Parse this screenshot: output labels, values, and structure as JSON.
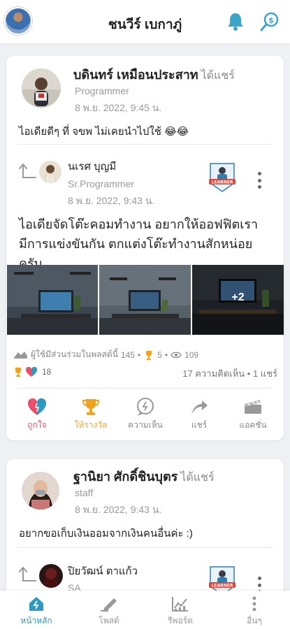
{
  "header": {
    "title": "ชนวีร์ เบกาภู่"
  },
  "post1": {
    "author_name": "บดินทร์ เหมือนประสาท",
    "shared_label": "ได้แชร์",
    "author_role": "Programmer",
    "date": "8 พ.ย. 2022, 9:45 น.",
    "text": "ไอเดียดีๆ ที่ จขพ ไม่เคยนำไปใช้ 😂😂",
    "original": {
      "author_name": "นเรศ บุญมี",
      "author_role": "Sr.Programmer",
      "date": "8 พ.ย. 2022, 9:43 น.",
      "badge_text": "LEARNER",
      "text": "ไอเดียจัดโต๊ะคอมทำงาน อยากให้ออฟฟิตเรามีการแข่งขันกัน ตกแต่งโต๊ะทำงานสักหน่อยครับ",
      "more_photos": "+2"
    },
    "stats": {
      "participants_label": "ผู้ใช้มีส่วนร่วมในพลสต์นี้",
      "participants": "145",
      "awards": "5",
      "views": "109",
      "reactions": "18",
      "comments_shares": "17 ความคิดเห็น • 1 แชร์"
    },
    "actions": {
      "like": "ถูกใจ",
      "award": "ให้รางวัล",
      "comment": "ความเห็น",
      "share": "แชร์",
      "acknowledge": "แอคชั่น"
    },
    "colors": {
      "like": "#e94f6a",
      "award": "#f2a31c",
      "inactive": "#888888"
    }
  },
  "post2": {
    "author_name": "ฐานิยา ศักดิ์ชินบุตร",
    "shared_label": "ได้แชร์",
    "author_role": "staff",
    "date": "8 พ.ย. 2022, 9:43 น.",
    "text": "อยากขอเก็บเงินออมจากเงินคนอื่นค่ะ :)",
    "original": {
      "author_name": "ปิยวัฒน์ ตาแก้ว",
      "author_role": "SA",
      "badge_text": "LEARNER"
    }
  },
  "bottom_nav": {
    "items": [
      "หน้าหลัก",
      "โพสต์",
      "รีพอร์ต",
      "อื่นๆ"
    ],
    "active_color": "#2c9bc4"
  }
}
